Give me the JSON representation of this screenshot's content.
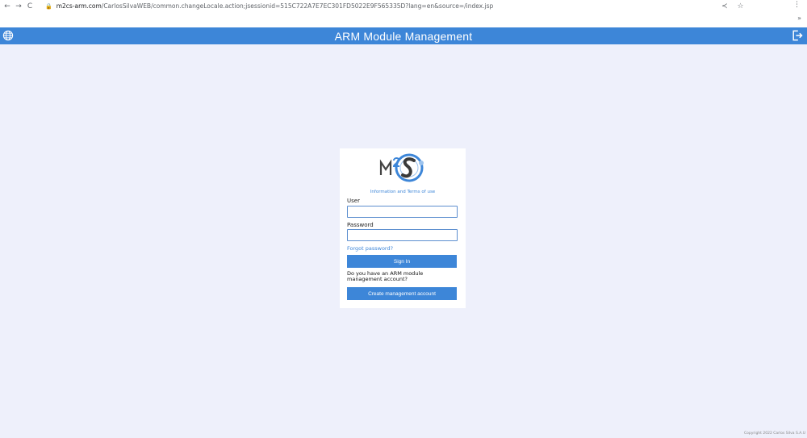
{
  "browser": {
    "back_icon": "←",
    "forward_icon": "→",
    "reload_icon": "C",
    "lock_icon": "🔒",
    "url_domain": "m2cs-arm.com",
    "url_path": "/CarlosSilvaWEB/common.changeLocale.action;jsessionid=515C722A7E7EC301FD5022E9F565335D?lang=en&source=/index.jsp",
    "share_icon": "≺",
    "star_icon": "☆",
    "menu_icon": "⋮",
    "extensions_icon": "»"
  },
  "header": {
    "title": "ARM Module Management",
    "background": "#3d86d8"
  },
  "login": {
    "logo_text": "M2S",
    "info_link": "Information and Terms of use",
    "user_label": "User",
    "user_value": "",
    "password_label": "Password",
    "password_value": "",
    "forgot_link": "Forgot password?",
    "sign_in_label": "Sign In",
    "account_question": "Do you have an ARM module management account?",
    "create_account_label": "Create management account"
  },
  "footer": {
    "copyright": "Copyright 2022 Carlos Silva S.A.U"
  }
}
